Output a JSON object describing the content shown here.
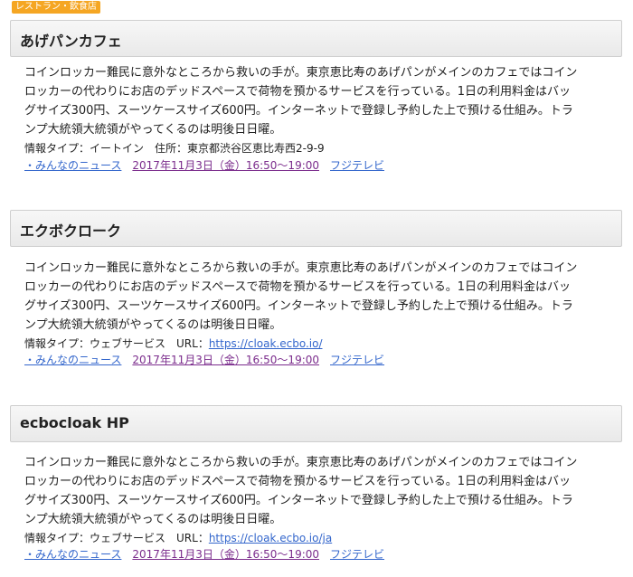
{
  "category_tag": "レストラン・飲食店",
  "entries": [
    {
      "title": "あげパンカフェ",
      "desc_lines": [
        "コインロッカー難民に意外なところから救いの手が。東京恵比寿のあげパンがメインのカフェではコイン",
        "ロッカーの代わりにお店のデッドスペースで荷物を預かるサービスを行っている。1日の利用料金はバッ",
        "グサイズ300円、スーツケースサイズ600円。インターネットで登録し予約した上で預ける仕組み。トラ",
        "ンプ大統領大統領がやってくるのは明後日日曜。"
      ],
      "info_label": "情報タイプ：イートイン",
      "extra_label": "住所：東京都渋谷区恵比寿西2-9-9",
      "extra_value": "",
      "program": "・みんなのニュース",
      "datetime": "2017年11月3日（金）16:50〜19:00",
      "channel": "フジテレビ"
    },
    {
      "title": "エクボクローク",
      "desc_lines": [
        "コインロッカー難民に意外なところから救いの手が。東京恵比寿のあげパンがメインのカフェではコイン",
        "ロッカーの代わりにお店のデッドスペースで荷物を預かるサービスを行っている。1日の利用料金はバッ",
        "グサイズ300円、スーツケースサイズ600円。インターネットで登録し予約した上で預ける仕組み。トラ",
        "ンプ大統領大統領がやってくるのは明後日日曜。"
      ],
      "info_label": "情報タイプ：ウェブサービス",
      "extra_label": "URL：",
      "extra_value": "https://cloak.ecbo.io/",
      "program": "・みんなのニュース",
      "datetime": "2017年11月3日（金）16:50〜19:00",
      "channel": "フジテレビ"
    },
    {
      "title": "ecbocloak HP",
      "desc_lines": [
        "コインロッカー難民に意外なところから救いの手が。東京恵比寿のあげパンがメインのカフェではコイン",
        "ロッカーの代わりにお店のデッドスペースで荷物を預かるサービスを行っている。1日の利用料金はバッ",
        "グサイズ300円、スーツケースサイズ600円。インターネットで登録し予約した上で預ける仕組み。トラ",
        "ンプ大統領大統領がやってくるのは明後日日曜。"
      ],
      "info_label": "情報タイプ：ウェブサービス",
      "extra_label": "URL：",
      "extra_value": "https://cloak.ecbo.io/ja",
      "program": "・みんなのニュース",
      "datetime": "2017年11月3日（金）16:50〜19:00",
      "channel": "フジテレビ"
    }
  ]
}
